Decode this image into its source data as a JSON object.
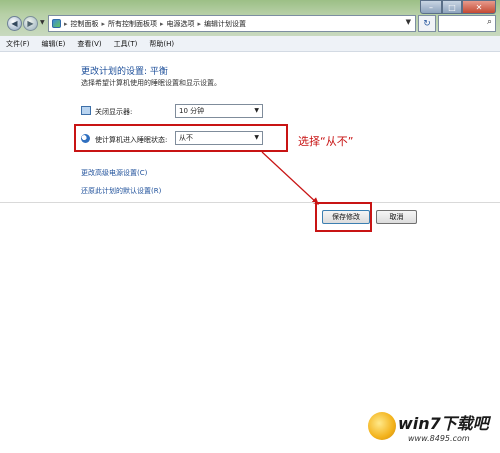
{
  "window": {
    "breadcrumbs": [
      "控制面板",
      "所有控制面板项",
      "电源选项",
      "编辑计划设置"
    ]
  },
  "menu": [
    "文件(F)",
    "编辑(E)",
    "查看(V)",
    "工具(T)",
    "帮助(H)"
  ],
  "main": {
    "heading": "更改计划的设置: 平衡",
    "subheading": "选择希望计算机使用的睡眠设置和显示设置。",
    "display_label": "关闭显示器:",
    "display_value": "10 分钟",
    "sleep_label": "使计算机进入睡眠状态:",
    "sleep_value": "从不",
    "advanced_link": "更改高级电源设置(C)",
    "restore_link": "还原此计划的默认设置(R)",
    "save_button": "保存修改",
    "cancel_button": "取消"
  },
  "annotation": "选择“从不”",
  "watermark": {
    "brand": "win7下载吧",
    "url": "www.8495.com"
  },
  "colors": {
    "highlight": "#c81414",
    "link": "#1d4f9a",
    "titlebar": "#b7d0a7"
  }
}
